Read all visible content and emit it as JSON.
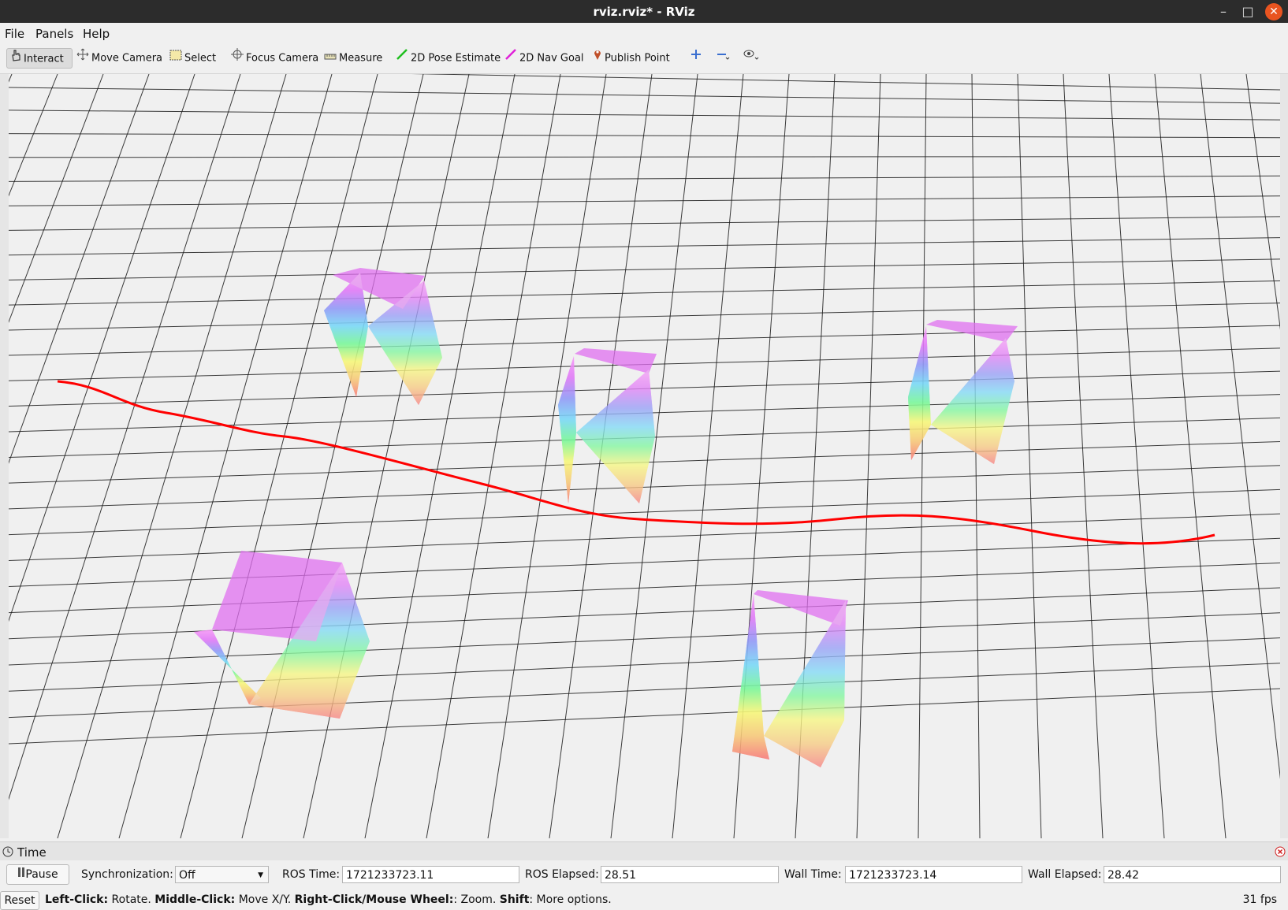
{
  "window": {
    "title": "rviz.rviz* - RViz"
  },
  "menu": {
    "file": "File",
    "panels": "Panels",
    "help": "Help"
  },
  "toolbar": {
    "interact": "Interact",
    "move_camera": "Move Camera",
    "select": "Select",
    "focus_camera": "Focus Camera",
    "measure": "Measure",
    "pose_estimate": "2D Pose Estimate",
    "nav_goal": "2D Nav Goal",
    "publish_point": "Publish Point"
  },
  "time_panel": {
    "title": "Time",
    "pause_label": "Pause",
    "sync_label": "Synchronization:",
    "sync_value": "Off",
    "ros_time_label": "ROS Time:",
    "ros_time": "1721233723.11",
    "ros_elapsed_label": "ROS Elapsed:",
    "ros_elapsed": "28.51",
    "wall_time_label": "Wall Time:",
    "wall_time": "1721233723.14",
    "wall_elapsed_label": "Wall Elapsed:",
    "wall_elapsed": "28.42"
  },
  "status": {
    "reset": "Reset",
    "h1": "Left-Click:",
    "t1": " Rotate. ",
    "h2": "Middle-Click:",
    "t2": " Move X/Y. ",
    "h3": "Right-Click/Mouse Wheel:",
    "t3": ": Zoom. ",
    "h4": "Shift",
    "t4": ": More options.",
    "fps": "31 fps"
  },
  "scene": {
    "grid_color": "#1a1a1a",
    "path_color": "#ff0000",
    "background": "#f0f0f0",
    "objects": [
      "point-cloud-box",
      "point-cloud-box",
      "point-cloud-box",
      "point-cloud-box",
      "point-cloud-box"
    ]
  }
}
